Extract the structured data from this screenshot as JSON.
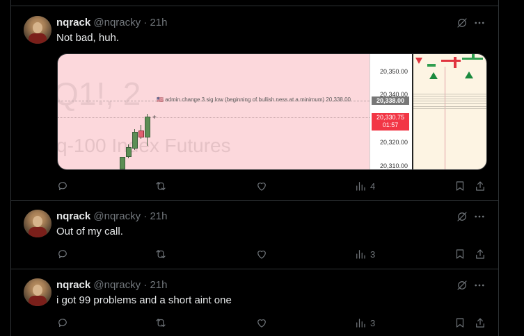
{
  "tweets": [
    {
      "name": "nqrack",
      "handle": "@nqracky",
      "dot": "·",
      "time": "21h",
      "text": "Not bad, huh.",
      "views": "4",
      "media": {
        "watermark_top": "Q1!, 2",
        "watermark_bottom": "q-100 Index Futures",
        "annotation": "🇺🇸 admin change 3 sig low (beginning of bullish ness at a minimum) 20,338.00",
        "price_labels": [
          "20,350.00",
          "20,340.00",
          "20,320.00",
          "20,310.00"
        ],
        "tag_grey": "20,338.00",
        "tag_red_price": "20,330.75",
        "tag_red_time": "01:57",
        "colors": {
          "chart_bg": "#fcd8dc",
          "tag_red": "#f23645",
          "tag_grey": "#777777",
          "right_panel_bg": "#fdf4e3"
        }
      }
    },
    {
      "name": "nqrack",
      "handle": "@nqracky",
      "dot": "·",
      "time": "21h",
      "text": "Out of my call.",
      "views": "3"
    },
    {
      "name": "nqrack",
      "handle": "@nqracky",
      "dot": "·",
      "time": "21h",
      "text": "i got 99 problems and a short aint one",
      "views": "3"
    }
  ],
  "icons": [
    "grok-icon",
    "more-icon",
    "reply-icon",
    "retweet-icon",
    "like-icon",
    "views-icon",
    "bookmark-icon",
    "share-icon"
  ]
}
